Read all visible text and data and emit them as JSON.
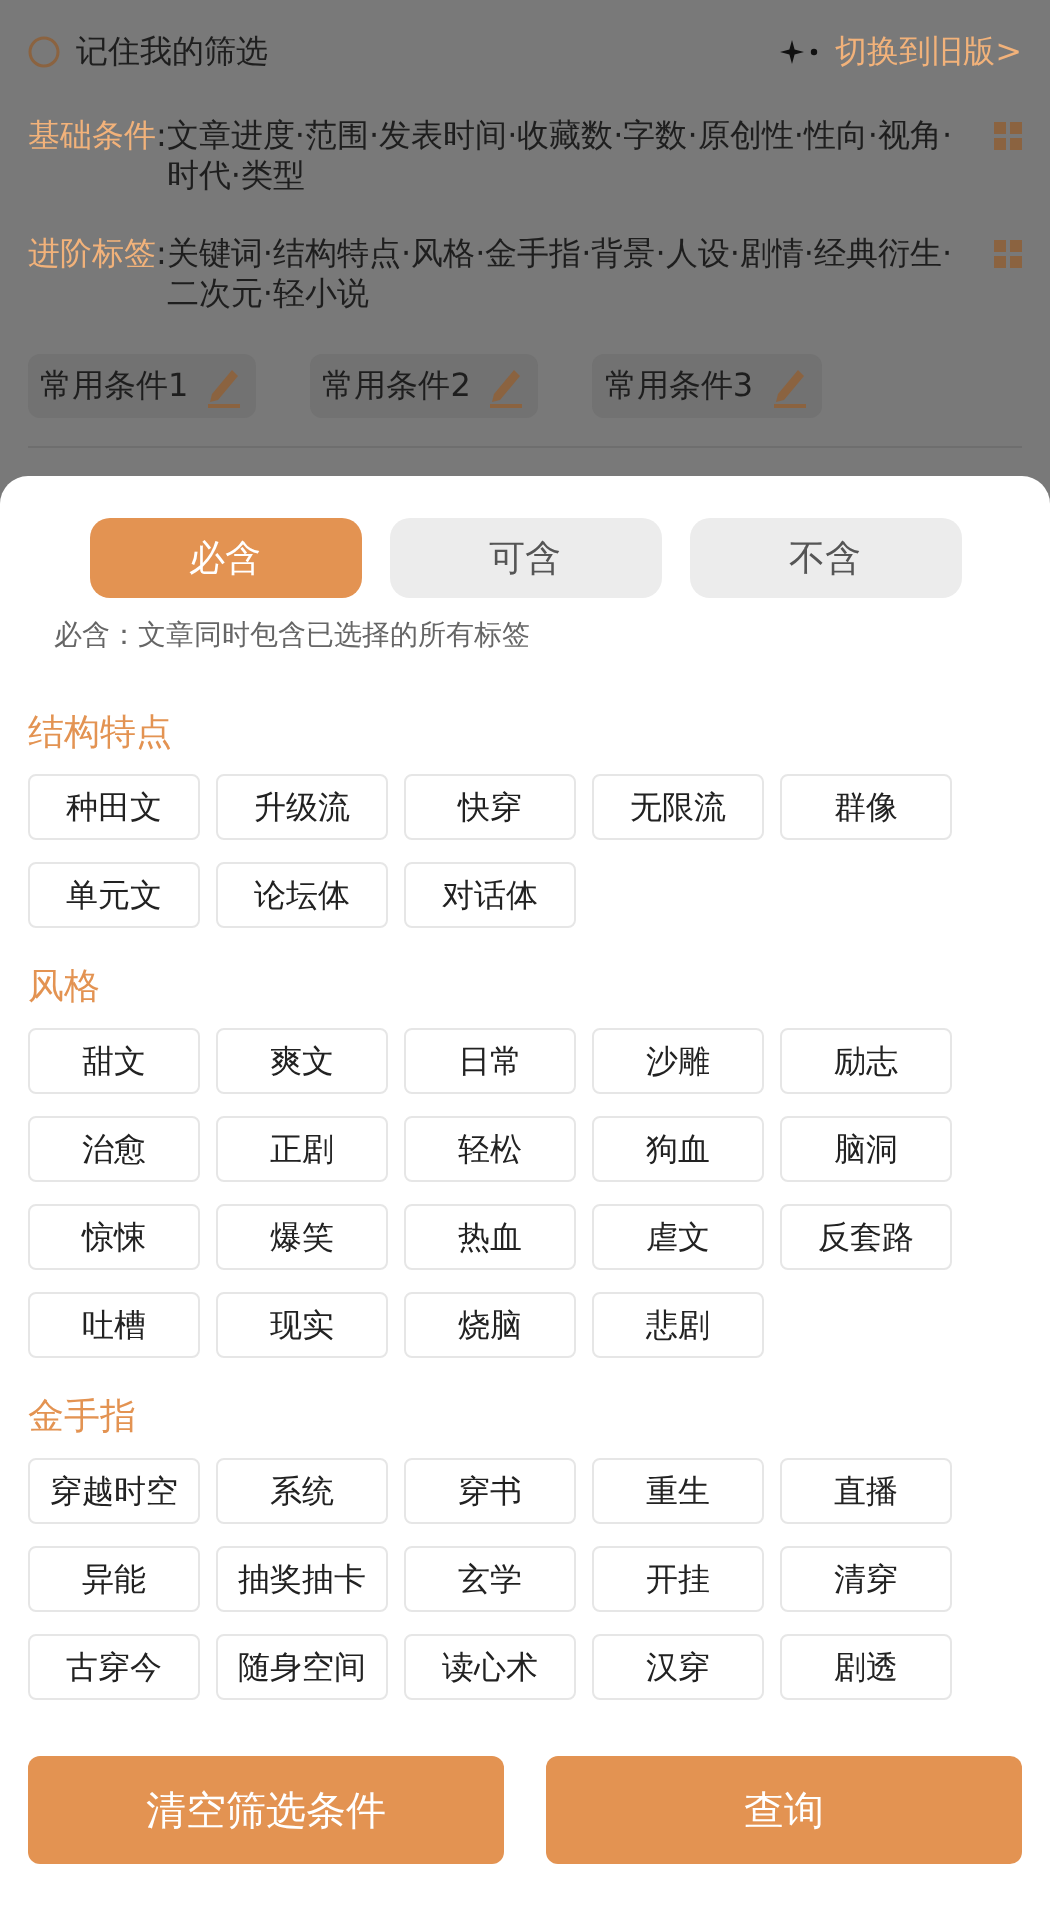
{
  "header": {
    "remember": {
      "label": "记住我的筛选",
      "checked": false
    },
    "switch_link": "切换到旧版>",
    "rows": [
      {
        "label": "基础条件",
        "colon": ":",
        "text": "文章进度·范围·发表时间·收藏数·字数·原创性·性向·视角·时代·类型"
      },
      {
        "label": "进阶标签",
        "colon": ":",
        "text": "关键词·结构特点·风格·金手指·背景·人设·剧情·经典衍生·二次元·轻小说"
      }
    ],
    "presets": [
      {
        "label": "常用条件1"
      },
      {
        "label": "常用条件2"
      },
      {
        "label": "常用条件3"
      }
    ]
  },
  "sheet": {
    "modes": [
      {
        "label": "必含",
        "selected": true
      },
      {
        "label": "可含",
        "selected": false
      },
      {
        "label": "不含",
        "selected": false
      }
    ],
    "hint": "必含：文章同时包含已选择的所有标签",
    "sections": [
      {
        "title": "结构特点",
        "tags": [
          "种田文",
          "升级流",
          "快穿",
          "无限流",
          "群像",
          "单元文",
          "论坛体",
          "对话体"
        ]
      },
      {
        "title": "风格",
        "tags": [
          "甜文",
          "爽文",
          "日常",
          "沙雕",
          "励志",
          "治愈",
          "正剧",
          "轻松",
          "狗血",
          "脑洞",
          "惊悚",
          "爆笑",
          "热血",
          "虐文",
          "反套路",
          "吐槽",
          "现实",
          "烧脑",
          "悲剧"
        ]
      },
      {
        "title": "金手指",
        "tags": [
          "穿越时空",
          "系统",
          "穿书",
          "重生",
          "直播",
          "异能",
          "抽奖抽卡",
          "玄学",
          "开挂",
          "清穿",
          "古穿今",
          "随身空间",
          "读心术",
          "汉穿",
          "剧透"
        ]
      }
    ]
  },
  "buttons": [
    "清空筛选条件",
    "查询"
  ]
}
